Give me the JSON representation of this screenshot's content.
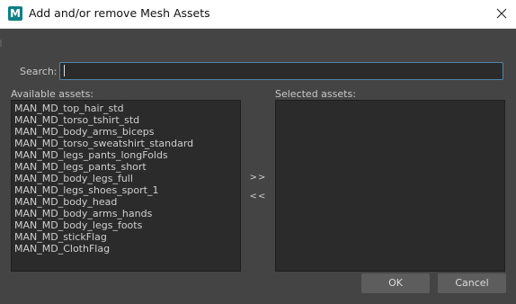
{
  "window": {
    "title": "Add and/or remove Mesh Assets",
    "icon_letter": "M",
    "icon_name": "maya-app-icon",
    "close_icon": "close-icon"
  },
  "search": {
    "label": "Search:",
    "value": ""
  },
  "available": {
    "label": "Available assets:",
    "items": [
      "MAN_MD_top_hair_std",
      "MAN_MD_torso_tshirt_std",
      "MAN_MD_body_arms_biceps",
      "MAN_MD_torso_sweatshirt_standard",
      "MAN_MD_legs_pants_longFolds",
      "MAN_MD_legs_pants_short",
      "MAN_MD_body_legs_full",
      "MAN_MD_legs_shoes_sport_1",
      "MAN_MD_body_head",
      "MAN_MD_body_arms_hands",
      "MAN_MD_body_legs_foots",
      "MAN_MD_stickFlag",
      "MAN_MD_ClothFlag"
    ]
  },
  "selected": {
    "label": "Selected assets:",
    "items": []
  },
  "transfer": {
    "add_label": ">>",
    "remove_label": "<<"
  },
  "buttons": {
    "ok_label": "OK",
    "cancel_label": "Cancel"
  },
  "colors": {
    "background": "#444444",
    "list_background": "#2b2b2b",
    "button": "#5d5d5d",
    "accent_border": "#5285a6",
    "icon_teal": "#0e7f86"
  }
}
